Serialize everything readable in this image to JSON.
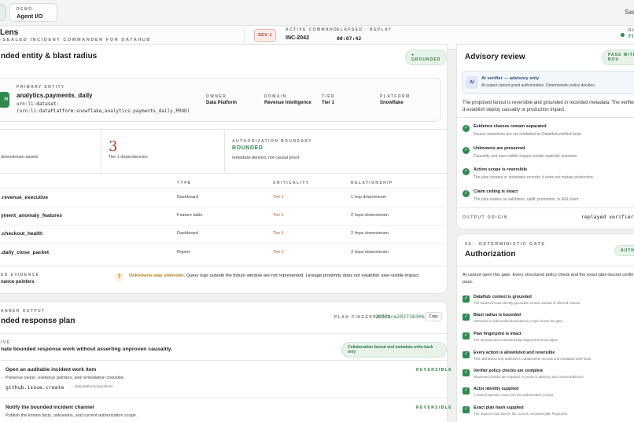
{
  "topbar": {
    "demo_label": "DEMO",
    "agent_label": "Agent I/O",
    "switch_label": "Swi"
  },
  "header": {
    "title": "Lens",
    "subtitle": "-SEALED INCIDENT COMMANDER FOR DATAHUB",
    "severity": "SEV-1",
    "active_command_label": "ACTIVE COMMAND",
    "active_command": "INC-2042",
    "elapsed_label": "ELAPSED · REPLAY",
    "elapsed": "00:07:42",
    "right_status_label": "RU",
    "right_status_value": "FI"
  },
  "entity": {
    "heading": "nded entity & blast radius",
    "grounded_badge": "● GROUNDED",
    "primary_label": "PRIMARY ENTITY",
    "primary_avatar": "H",
    "primary_name": "analytics.payments_daily",
    "urn_line1": "urn:li:dataset:",
    "urn_line2": "(urn:li:dataPlatform:snowflake,analytics.payments_daily,PROD)",
    "meta": [
      {
        "label": "OWNER",
        "value": "Data Platform"
      },
      {
        "label": "DOMAIN",
        "value": "Revenue Intelligence"
      },
      {
        "label": "TIER",
        "value": "Tier 1"
      },
      {
        "label": "PLATFORM",
        "value": "Snowflake"
      }
    ],
    "stat1_label": "downstream assets",
    "stat2_value": "3",
    "stat2_label": "Tier 1 dependencies",
    "boundary_label": "AUTHORIZATION BOUNDARY",
    "boundary_value": "BOUNDED",
    "boundary_note": "metadata-derived, not causal proof",
    "table_headers": {
      "type": "TYPE",
      "criticality": "CRITICALITY",
      "relationship": "RELATIONSHIP"
    },
    "rows": [
      {
        "name": ".revenue_executive",
        "type": "Dashboard",
        "tier": "Tier 1",
        "rel": "1 hop downstream"
      },
      {
        "name": "yment_anomaly_features",
        "type": "Feature table",
        "tier": "Tier 1",
        "rel": "2 hops downstream"
      },
      {
        "name": ".checkout_health",
        "type": "Dashboard",
        "tier": "Tier 1",
        "rel": "2 hops downstream"
      },
      {
        "name": ".daily_close_packet",
        "type": "Report",
        "tier": "Tier 2",
        "rel": "3 hops downstream"
      }
    ],
    "evidence_label": "ED EVIDENCE",
    "evidence_value": "nance pointers",
    "unknown_strong": "Unknowns stay unknown.",
    "unknown_text": "Query logs outside the fixture window are not represented. Lineage proximity does not establish user-visible impact."
  },
  "plan": {
    "cap": "ANNER OUTPUT",
    "heading": "nded response plan",
    "fingerprint_label": "PLAN FINGERPRINT",
    "fingerprint": "20f3ace20273830b",
    "copy": "Copy",
    "objective_cap": "IVE",
    "objective": "nate bounded response work without asserting unproven causality.",
    "collab_badge": "Collaboration fanout and metadata write-back only",
    "actions": [
      {
        "title": "Open an auditable incident work item",
        "desc": "Preserve owner, evidence pointers, and remediation checklist.",
        "code": "github.issue.create",
        "target": "→ data-platform/operations",
        "badge": "REVERSIBLE"
      },
      {
        "title": "Notify the bounded incident channel",
        "desc": "Publish the known facts, unknowns, and current authorization scope.",
        "badge": "REVERSIBLE"
      }
    ]
  },
  "advisory": {
    "heading": "Advisory review",
    "badge": "PASS WITH BOU",
    "verifier_title": "AI verifier — advisory only",
    "verifier_desc": "AI output cannot grant authorization. Deterministic policy decides.",
    "avatar": "AI",
    "summary": "The proposed fanout is reversible and grounded in recorded metadata. The verifier d establish deploy causality or production impact.",
    "checks": [
      {
        "title": "Evidence classes remain separated",
        "desc": "Source assertions are not relabeled as DataHub-verified facts."
      },
      {
        "title": "Unknowns are preserved",
        "desc": "Causality and user-visible impact remain explicitly unknown."
      },
      {
        "title": "Action scope is reversible",
        "desc": "The plan creates or annotates records; it does not mutate production."
      },
      {
        "title": "Claim ceiling is intact",
        "desc": "The plan makes no validation, uplift, promotion, or AGI claim."
      }
    ],
    "origin_label": "OUTPUT ORIGIN",
    "origin_value": "replayed verifier o"
  },
  "gate": {
    "cap": "06 · DETERMINISTIC GATE",
    "heading": "Authorization",
    "badge": "AUTHO",
    "summary": "AI cannot open this gate. Every structured policy check and the exact plan-bound confirma pass.",
    "checks": [
      {
        "title": "DataHub context is grounded",
        "desc": "The backend must identify grounded context instead of inferred context."
      },
      {
        "title": "Blast radius is bounded",
        "desc": "Unknown or unbounded dependency scope closes the gate."
      },
      {
        "title": "Plan fingerprint is intact",
        "desc": "The reported and computed plan fingerprints must agree."
      },
      {
        "title": "Every action is allowlisted and reversible",
        "desc": "This dashboard only authorizes collaboration records and metadata write-back."
      },
      {
        "title": "Verifier policy checks are complete",
        "desc": "Structured checks are required. AI prose is advisory and cannot authorize."
      },
      {
        "title": "Actor identity supplied",
        "desc": "A named operator must own the authorization receipt."
      },
      {
        "title": "Exact plan hash supplied",
        "desc": "The request must bind to the current computed plan fingerprint."
      }
    ]
  },
  "icons": {
    "check": "check-icon",
    "warning": "warning-icon",
    "status": "status-dot-icon"
  },
  "colors": {
    "accent_green": "#2e8a4e",
    "tier_orange": "#c4572a",
    "sev_red": "#c0392b"
  }
}
